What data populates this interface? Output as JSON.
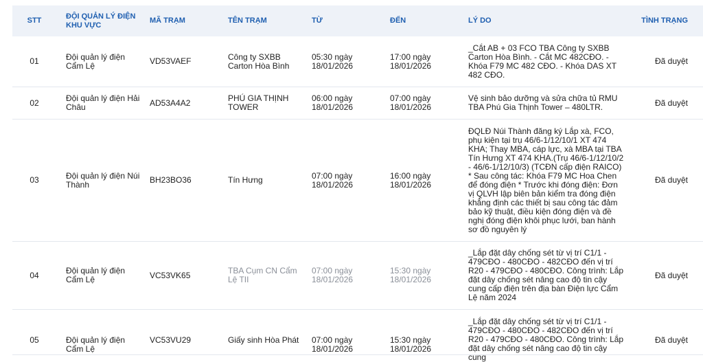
{
  "header": {
    "stt": "STT",
    "khu_vuc": "ĐỘI QUẢN LÝ ĐIỆN KHU VỰC",
    "ma_tram": "MÃ TRẠM",
    "ten_tram": "TÊN TRẠM",
    "tu": "TỪ",
    "den": "ĐẾN",
    "ly_do": "LÝ DO",
    "tinh_trang": "TÌNH TRẠNG"
  },
  "rows": [
    {
      "stt": "01",
      "khu_vuc": "Đội quản lý điện Cẩm Lệ",
      "ma_tram": "VD53VAEF",
      "ten_tram": "Công ty SXBB Carton Hòa Bình",
      "tu": "05:30 ngày 18/01/2026",
      "den": "17:00 ngày 18/01/2026",
      "ly_do": "_Cắt AB + 03 FCO TBA Công ty SXBB Carton Hòa Bình. - Cắt MC 482CĐO. - Khóa F79 MC 482 CĐO. - Khóa DAS XT 482 CĐO.",
      "tinh_trang": "Đã duyệt"
    },
    {
      "stt": "02",
      "khu_vuc": "Đội quản lý điện Hải Châu",
      "ma_tram": "AD53A4A2",
      "ten_tram": "PHÚ GIA THỊNH TOWER",
      "tu": "06:00 ngày 18/01/2026",
      "den": "07:00 ngày 18/01/2026",
      "ly_do": "Vệ sinh bảo dưỡng và sửa chữa tủ RMU TBA Phú Gia Thịnh Tower – 480LTR.",
      "tinh_trang": "Đã duyệt"
    },
    {
      "stt": "03",
      "khu_vuc": "Đội quản lý điện Núi Thành",
      "ma_tram": "BH23BO36",
      "ten_tram": "Tín Hưng",
      "tu": "07:00 ngày 18/01/2026",
      "den": "16:00 ngày 18/01/2026",
      "ly_do": "ĐQLĐ Núi Thành đăng ký Lắp xà, FCO, phụ kiện tại trụ 46/6-1/12/10/1 XT 474 KHA; Thay MBA, cáp lực, xà MBA tại TBA Tín Hưng XT 474 KHA.(Trụ 46/6-1/12/10/2 - 46/6-1/12/10/3) (TCĐN cấp điện RAICO) * Sau công tác: Khóa F79 MC Hoa Chen để đóng điện * Trước khi đóng điện: Đơn vị QLVH lập biên bản kiểm tra đóng điện khẳng định các thiết bị sau công tác đảm bảo kỹ thuật, điều kiện đóng điện và đề nghị đóng điện khôi phục lưới, ban hành sơ đồ nguyên lý",
      "tinh_trang": "Đã duyệt"
    },
    {
      "stt": "04",
      "khu_vuc": "Đội quản lý điện Cẩm Lệ",
      "ma_tram": "VC53VK65",
      "ten_tram": "TBA Cụm CN Cẩm Lệ TII",
      "tu": "07:00 ngày 18/01/2026",
      "den": "15:30 ngày 18/01/2026",
      "ly_do": "_Lắp đặt dây chống sét từ vị trí C1/1 - 479CĐO - 480CĐO - 482CĐO đến vị trí R20 - 479CĐO - 480CĐO. Công trình: Lắp đặt dây chống sét nâng cao độ tin cậy cung cấp điện trên địa bàn Điện lực Cẩm Lệ năm 2024",
      "tinh_trang": "Đã duyệt"
    },
    {
      "stt": "05",
      "khu_vuc": "Đội quản lý điện Cẩm Lệ",
      "ma_tram": "VC53VU29",
      "ten_tram": "Giấy sinh Hòa Phát",
      "tu": "07:00 ngày 18/01/2026",
      "den": "15:30 ngày 18/01/2026",
      "ly_do": "_Lắp đặt dây chống sét từ vị trí C1/1 - 479CĐO - 480CĐO - 482CĐO đến vị trí R20 - 479CĐO - 480CĐO. Công trình: Lắp đặt dây chống sét nâng cao độ tin cậy cung",
      "tinh_trang": "Đã duyệt"
    }
  ]
}
